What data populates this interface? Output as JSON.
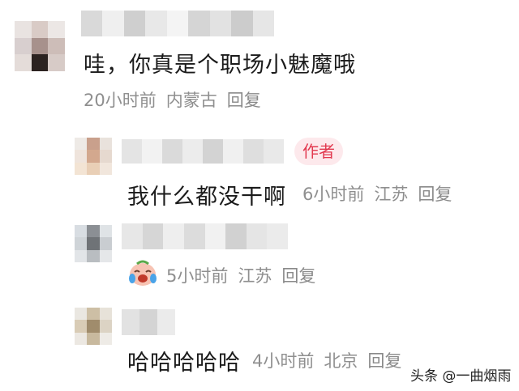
{
  "comments": [
    {
      "text": "哇，你真是个职场小魅魔哦",
      "time": "20小时前",
      "location": "内蒙古",
      "reply": "回复"
    },
    {
      "badge": "作者",
      "text": "我什么都没干啊",
      "time": "6小时前",
      "location": "江苏",
      "reply": "回复"
    },
    {
      "time": "5小时前",
      "location": "江苏",
      "reply": "回复",
      "emoji_icon": "laughing-face-emoji-icon"
    },
    {
      "text": "哈哈哈哈哈",
      "time": "4小时前",
      "location": "北京",
      "reply": "回复"
    }
  ],
  "watermark": "头条 @一曲烟雨",
  "colors": {
    "badge_bg": "#fde9ec",
    "badge_text": "#e2394f",
    "meta_text": "#8f8f8f"
  }
}
